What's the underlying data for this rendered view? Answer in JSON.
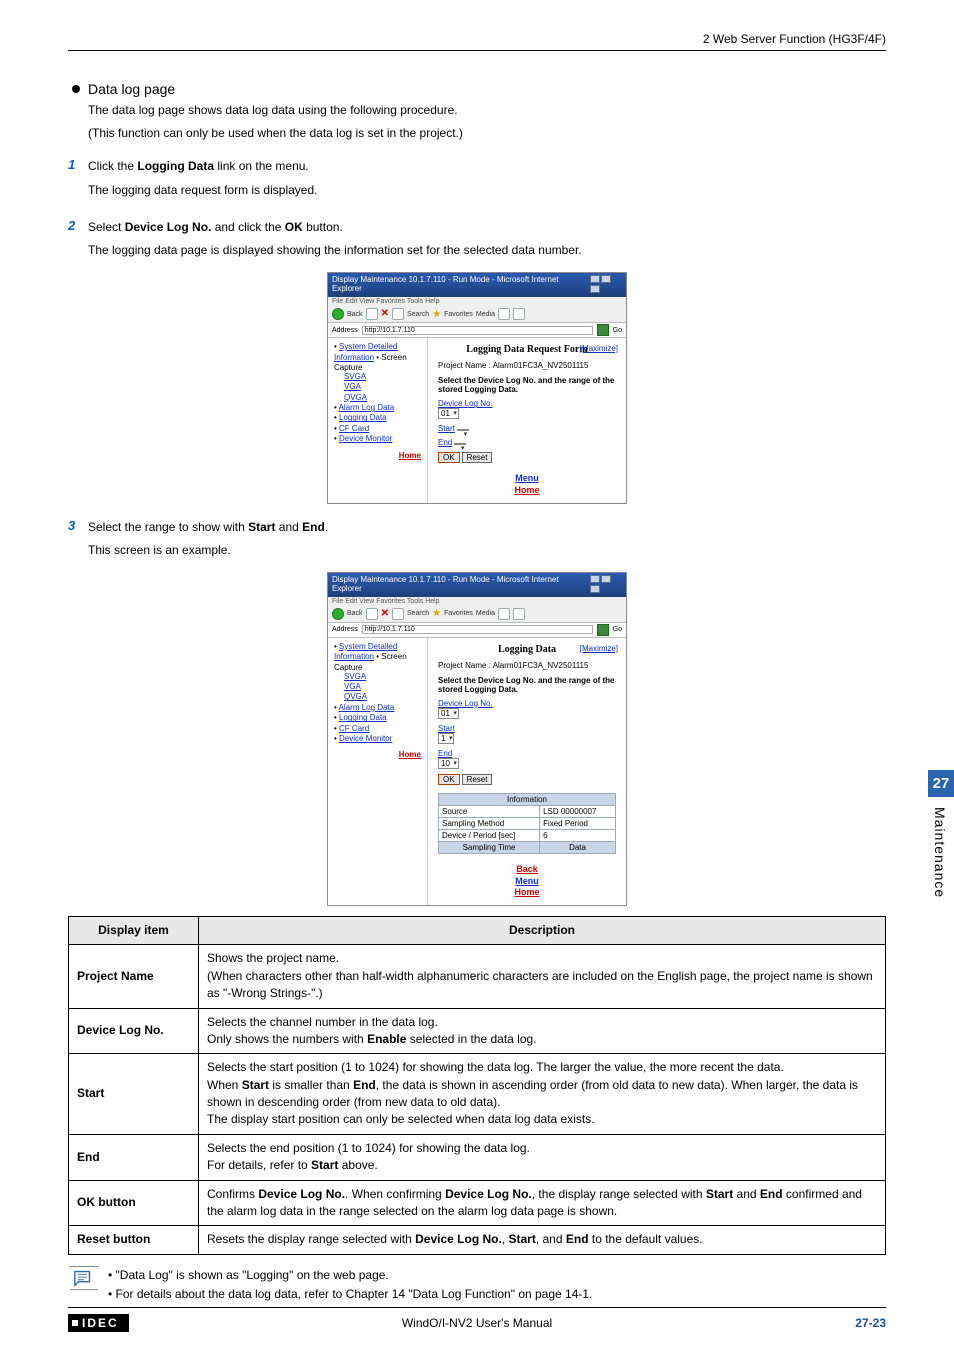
{
  "header": {
    "right": "2 Web Server Function (HG3F/4F)"
  },
  "section": {
    "title": "Data log page",
    "intro1": "The data log page shows data log data using the following procedure.",
    "intro2": "(This function can only be used when the data log is set in the project.)"
  },
  "steps": [
    {
      "num": "1",
      "line1_a": "Click the ",
      "line1_b": "Logging Data",
      "line1_c": " link on the menu.",
      "line2": "The logging data request form is displayed."
    },
    {
      "num": "2",
      "line1_a": "Select ",
      "line1_b": "Device Log No.",
      "line1_c": " and click the ",
      "line1_d": "OK",
      "line1_e": " button.",
      "line2": "The logging data page is displayed showing the information set for the selected data number."
    },
    {
      "num": "3",
      "line1_a": "Select the range to show with ",
      "line1_b": "Start",
      "line1_c": " and ",
      "line1_d": "End",
      "line1_e": ".",
      "line2": "This screen is an example."
    }
  ],
  "fig_common": {
    "menubar": "File   Edit   View   Favorites   Tools   Help",
    "back": "Back",
    "search": "Search",
    "favorites": "Favorites",
    "media": "Media",
    "address_label": "Address",
    "address_value": "http://10.1.7.110",
    "go": "Go",
    "side_links": {
      "sys": "System Detailed Information",
      "screen": "Screen Capture",
      "svga": "SVGA",
      "vga": "VGA",
      "qvga": "QVGA",
      "alarm": "Alarm Log Data",
      "logging": "Logging Data",
      "cf": "CF Card",
      "device": "Device Monitor",
      "home": "Home"
    },
    "maximize": "[Maximize]",
    "project_label": "Project Name : ",
    "project_value": "Alarm01FC3A_NV2501115",
    "select_text": "Select the Device Log No. and the range of the stored Logging Data.",
    "devlog_label": "Device Log No.",
    "start_label": "Start",
    "end_label": "End",
    "ok": "OK",
    "reset": "Reset",
    "menu": "Menu",
    "home2": "Home",
    "back2": "Back"
  },
  "fig1": {
    "titlebar": "Display Maintenance 10.1.7.110 - Run Mode - Microsoft Internet Explorer",
    "heading": "Logging Data Request Form",
    "devlog_val": "01",
    "start_val": "",
    "end_val": ""
  },
  "fig2": {
    "titlebar": "Display Maintenance 10.1.7.110 - Run Mode - Microsoft Internet Explorer",
    "heading": "Logging Data",
    "devlog_val": "01",
    "start_val": "1",
    "end_val": "10",
    "info_header": "Information",
    "rows": [
      {
        "k": "Source",
        "v": "LSD 00000007"
      },
      {
        "k": "Sampling Method",
        "v": "Fixed Period"
      },
      {
        "k": "Device / Period [sec]",
        "v": "6"
      }
    ],
    "data_row": {
      "k": "Sampling Time",
      "v": "Data"
    }
  },
  "table": {
    "head_item": "Display item",
    "head_desc": "Description",
    "rows": [
      {
        "item": "Project Name",
        "desc_parts": [
          "Shows the project name.",
          "(When characters other than half-width alphanumeric characters are included on the English page, the project name is shown as \"-Wrong Strings-\".)"
        ]
      },
      {
        "item": "Device Log No.",
        "desc_parts": [
          "Selects the channel number in the data log.",
          "Only shows the numbers with <b>Enable</b> selected in the data log."
        ]
      },
      {
        "item": "Start",
        "desc_parts": [
          "Selects the start position (1 to 1024) for showing the data log. The larger the value, the more recent the data.",
          "When <b>Start</b> is smaller than <b>End</b>, the data is shown in ascending order (from old data to new data). When larger, the data is shown in descending order (from new data to old data).",
          "The display start position can only be selected when data log data exists."
        ]
      },
      {
        "item": "End",
        "desc_parts": [
          "Selects the end position (1 to 1024) for showing the data log.",
          "For details, refer to <b>Start</b> above."
        ]
      },
      {
        "item": "<b>OK</b> button",
        "desc_parts": [
          "Confirms <b>Device Log No.</b>. When confirming <b>Device Log No.</b>, the display range selected with <b>Start</b> and <b>End</b> confirmed and the alarm log data in the range selected on the alarm log data page is shown."
        ]
      },
      {
        "item": "<b>Reset</b> button",
        "desc_parts": [
          "Resets the display range selected with <b>Device Log No.</b>, <b>Start</b>, and <b>End</b> to the default values."
        ]
      }
    ]
  },
  "notes": [
    "\"Data Log\" is shown as \"Logging\" on the web page.",
    "For details about the data log data, refer to Chapter 14 \"Data Log Function\" on page 14-1."
  ],
  "sidetab": {
    "num": "27",
    "text": "Maintenance"
  },
  "footer": {
    "brand": "IDEC",
    "center": "WindO/I-NV2 User's Manual",
    "page": "27-23"
  }
}
